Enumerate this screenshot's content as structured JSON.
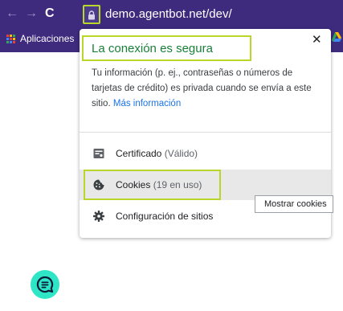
{
  "browser": {
    "url": "demo.agentbot.net/dev/",
    "bookmark_apps_label": "Aplicaciones"
  },
  "site_info_popup": {
    "title": "La conexión es segura",
    "description": "Tu información (p. ej., contraseñas o números de tarjetas de crédito) es privada cuando se envía a este sitio.",
    "more_info_link": "Más información",
    "rows": [
      {
        "label": "Certificado",
        "detail": "(Válido)",
        "icon": "certificate-icon"
      },
      {
        "label": "Cookies",
        "detail": "(19 en uso)",
        "icon": "cookie-icon"
      },
      {
        "label": "Configuración de sitios",
        "detail": "",
        "icon": "gear-icon"
      }
    ]
  },
  "tooltip": {
    "text": "Mostrar cookies"
  },
  "colors": {
    "browser_bar": "#3f2b7e",
    "highlight": "#b9d72a",
    "secure_green": "#188038",
    "link_blue": "#1a73e8",
    "chat_fab": "#2ee6c6"
  }
}
